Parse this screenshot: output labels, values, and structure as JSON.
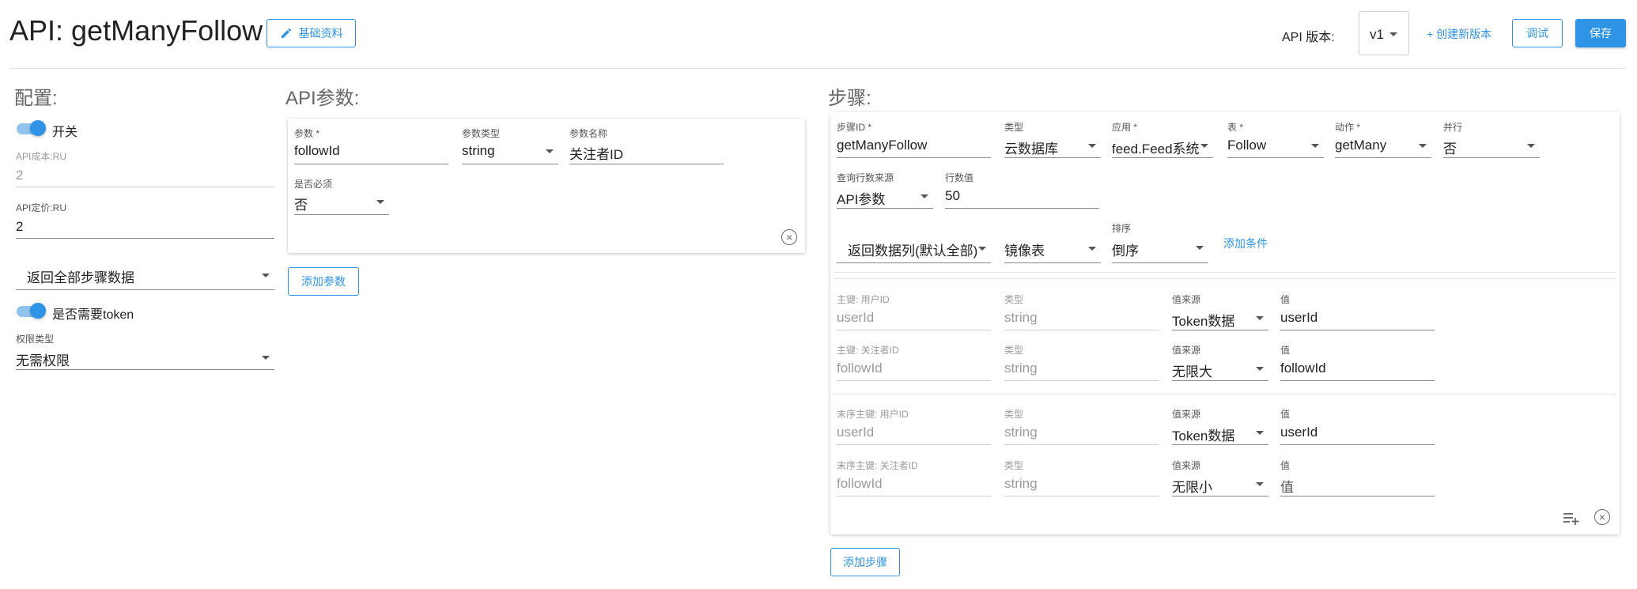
{
  "header": {
    "title": "API: getManyFollow",
    "basic_info_label": "基础资料",
    "version_label": "API 版本:",
    "version_value": "v1",
    "create_version_label": "+ 创建新版本",
    "debug_label": "调试",
    "save_label": "保存"
  },
  "config": {
    "title": "配置:",
    "switch_label": "开关",
    "cost_label": "API成本:RU",
    "cost_value": "2",
    "price_label": "API定价:RU",
    "price_value": "2",
    "return_select": "返回全部步骤数据",
    "token_label": "是否需要token",
    "permission_label": "权限类型",
    "permission_value": "无需权限"
  },
  "params": {
    "title": "API参数:",
    "param_label": "参数 *",
    "param_value": "followId",
    "type_label": "参数类型",
    "type_value": "string",
    "name_label": "参数名称",
    "name_value": "关注者ID",
    "required_label": "是否必须",
    "required_value": "否",
    "add_label": "添加参数"
  },
  "steps": {
    "title": "步骤:",
    "step_id_label": "步骤ID *",
    "step_id_value": "getManyFollow",
    "type_label": "类型",
    "type_value": "云数据库",
    "app_label": "应用 *",
    "app_value": "feed.Feed系统",
    "table_label": "表 *",
    "table_value": "Follow",
    "action_label": "动作 *",
    "action_value": "getMany",
    "parallel_label": "并行",
    "parallel_value": "否",
    "rows_source_label": "查询行数来源",
    "rows_source_value": "API参数",
    "rows_value_label": "行数值",
    "rows_value": "50",
    "return_columns": "返回数据列(默认全部)",
    "mirror_table": "镜像表",
    "sort_label": "排序",
    "sort_value": "倒序",
    "add_condition": "添加条件",
    "keys": [
      {
        "key_label": "主键: 用户ID",
        "key_value": "userId",
        "type_label": "类型",
        "type_value": "string",
        "source_label": "值来源",
        "source_value": "Token数据",
        "value_label": "值",
        "value": "userId"
      },
      {
        "key_label": "主键: 关注者ID",
        "key_value": "followId",
        "type_label": "类型",
        "type_value": "string",
        "source_label": "值来源",
        "source_value": "无限大",
        "value_label": "值",
        "value": "followId"
      },
      {
        "key_label": "末序主键: 用户ID",
        "key_value": "userId",
        "type_label": "类型",
        "type_value": "string",
        "source_label": "值来源",
        "source_value": "Token数据",
        "value_label": "值",
        "value": "userId"
      },
      {
        "key_label": "末序主键: 关注者ID",
        "key_value": "followId",
        "type_label": "类型",
        "type_value": "string",
        "source_label": "值来源",
        "source_value": "无限小",
        "value_label": "值",
        "value": "值"
      }
    ],
    "add_step_label": "添加步骤"
  },
  "colors": {
    "accent": "#2f93e6",
    "toggle_track": "#90c4ee"
  },
  "icons": [
    "pencil-icon",
    "chevron-down-icon",
    "close-circle-icon",
    "playlist-add-icon"
  ]
}
